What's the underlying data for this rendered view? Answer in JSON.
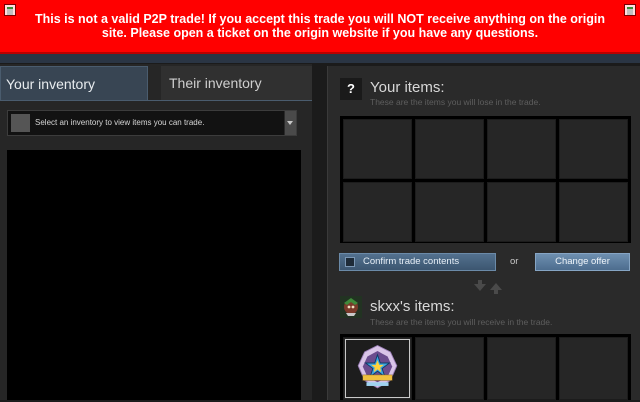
{
  "banner": {
    "message": "This is not a valid P2P trade! If you accept this trade you will NOT receive anything on the origin site. Please open a ticket on the origin website if you have any questions."
  },
  "inventory_tabs": {
    "your_label": "Your inventory",
    "their_label": "Their inventory"
  },
  "inventory_selector": {
    "placeholder": "Select an inventory to view items you can trade."
  },
  "your_items": {
    "badge": "?",
    "title": "Your items:",
    "subtitle": "These are the items you will lose in the trade."
  },
  "actions": {
    "confirm_label": "Confirm trade contents",
    "or_label": "or",
    "change_label": "Change offer"
  },
  "their_items": {
    "title": "skxx's items:",
    "subtitle": "These are the items you will receive in the trade."
  },
  "colors": {
    "banner": "#ff0000",
    "accent": "#53718f",
    "panel": "#2a2a2a"
  }
}
